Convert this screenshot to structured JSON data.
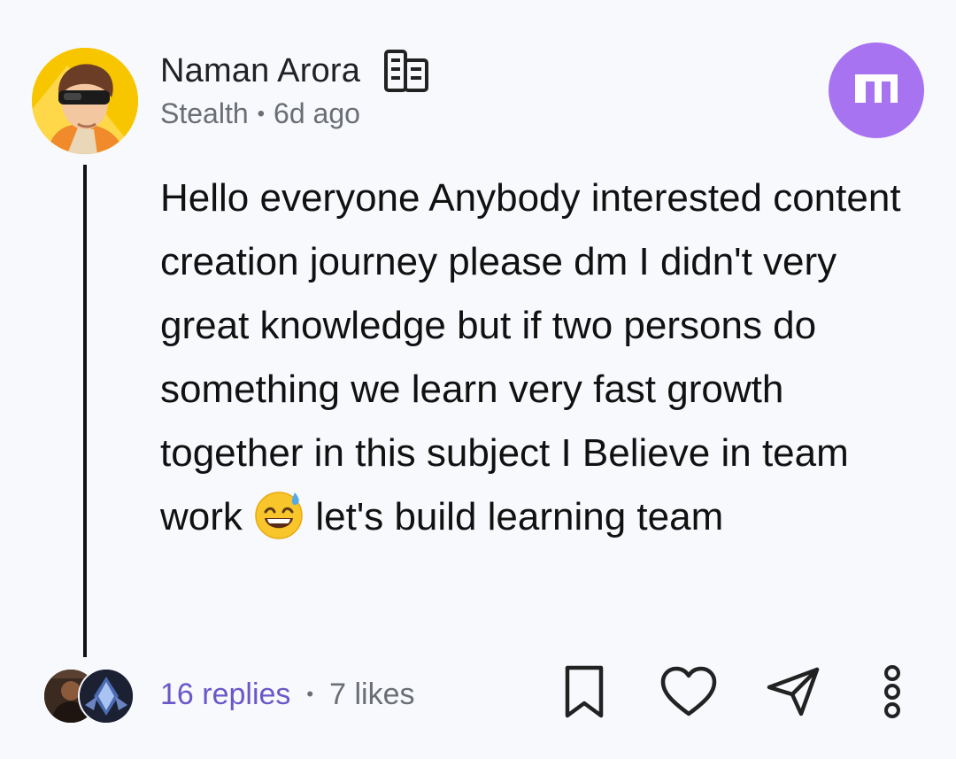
{
  "author": {
    "name": "Naman Arora",
    "company": "Stealth",
    "time_ago": "6d ago",
    "meta_separator": "•"
  },
  "post": {
    "text_before_emoji": "Hello everyone Anybody interested content creation journey please dm I didn't very great knowledge but if two persons do something we learn very fast growth together in this subject I Believe in team work ",
    "emoji": "sweat-smile-emoji",
    "text_after_emoji": " let's build learning team"
  },
  "footer": {
    "replies_label": "16 replies",
    "separator": "•",
    "likes_label": "7 likes"
  },
  "icons": {
    "company": "building-icon",
    "brand": "community-logo-icon",
    "bookmark": "bookmark-icon",
    "like": "heart-icon",
    "share": "send-icon",
    "more": "more-vertical-icon"
  },
  "colors": {
    "background": "#f7f9fc",
    "brand_badge": "#a873f0",
    "replies_link": "#6b57c9",
    "muted_text": "#6b6f75",
    "thread_line": "#111111"
  }
}
